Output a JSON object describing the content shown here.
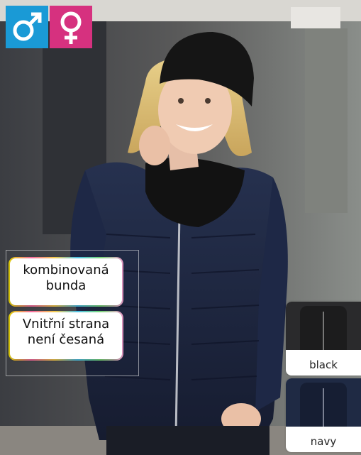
{
  "gender_icons": [
    {
      "icon": "male-icon",
      "bg": "#1a9ad6"
    },
    {
      "icon": "female-icon",
      "bg": "#d6317f"
    }
  ],
  "features": [
    {
      "line1": "kombinovaná",
      "line2": "bunda"
    },
    {
      "line1": "Vnitřní strana",
      "line2": "není česaná"
    }
  ],
  "colors": [
    {
      "label": "black",
      "swatch": "#2a2a2c"
    },
    {
      "label": "navy",
      "swatch": "#1f2a44"
    }
  ]
}
